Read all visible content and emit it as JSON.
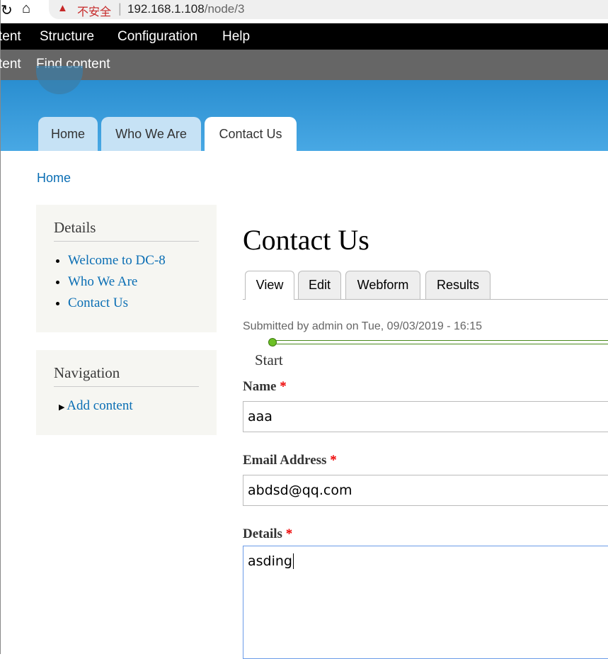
{
  "browser": {
    "warning": "不安全",
    "url_host": "192.168.1.108",
    "url_path": "/node/3"
  },
  "toolbar": {
    "items": [
      "tent",
      "Structure",
      "Configuration",
      "Help"
    ],
    "secondary": [
      "tent",
      "Find content"
    ]
  },
  "primary_tabs": [
    "Home",
    "Who We Are",
    "Contact Us"
  ],
  "breadcrumb": "Home",
  "sidebar": {
    "details_title": "Details",
    "details_links": [
      "Welcome to DC-8",
      "Who We Are",
      "Contact Us"
    ],
    "nav_title": "Navigation",
    "nav_links": [
      "Add content"
    ]
  },
  "main": {
    "title": "Contact Us",
    "tabs": [
      "View",
      "Edit",
      "Webform",
      "Results"
    ],
    "submitted": "Submitted by admin on Tue, 09/03/2019 - 16:15",
    "progress_step": "Start",
    "fields": [
      {
        "label": "Name",
        "value": "aaa"
      },
      {
        "label": "Email Address",
        "value": "abdsd@qq.com"
      },
      {
        "label": "Details",
        "value": "asding"
      }
    ],
    "required_mark": "*"
  },
  "colors": {
    "accent": "#0a6eb4",
    "progress": "#4a8a1c"
  }
}
